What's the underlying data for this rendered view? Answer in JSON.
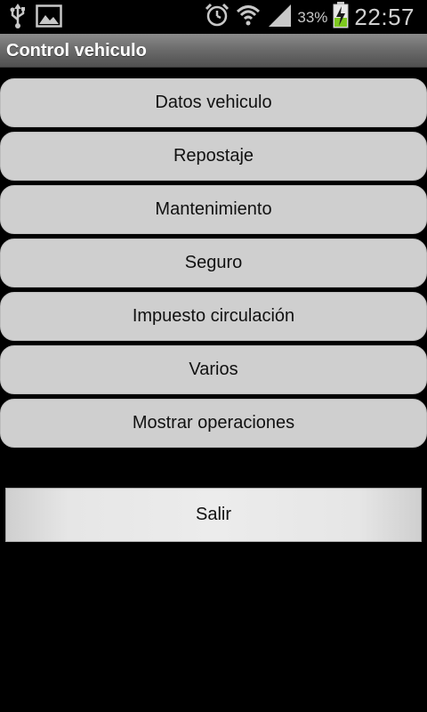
{
  "status_bar": {
    "battery_percent": "33%",
    "time": "22:57",
    "icons": [
      "usb-icon",
      "image-notification-icon",
      "alarm-icon",
      "wifi-icon",
      "signal-icon",
      "battery-charging-icon"
    ]
  },
  "title_bar": {
    "title": "Control vehiculo"
  },
  "menu": {
    "items": [
      {
        "label": "Datos vehiculo"
      },
      {
        "label": "Repostaje"
      },
      {
        "label": "Mantenimiento"
      },
      {
        "label": "Seguro"
      },
      {
        "label": "Impuesto circulación"
      },
      {
        "label": "Varios"
      },
      {
        "label": "Mostrar operaciones"
      }
    ]
  },
  "exit_button": {
    "label": "Salir"
  },
  "colors": {
    "background": "#000000",
    "button_fill": "#cfcfcf",
    "title_bar": "#6a6a6a",
    "battery_green": "#7ec820"
  }
}
